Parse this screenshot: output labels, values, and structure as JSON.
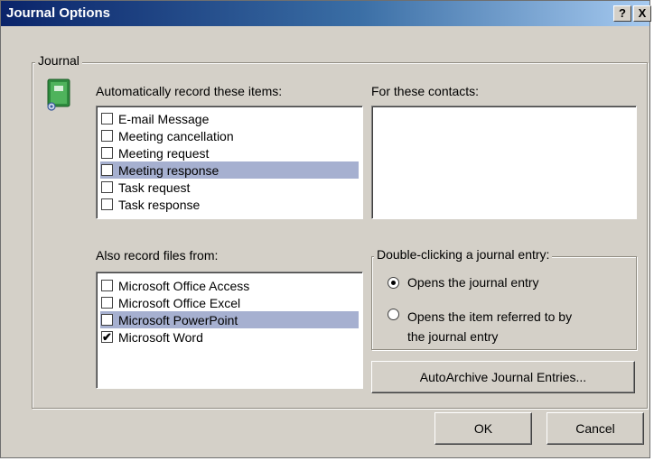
{
  "window": {
    "title": "Journal Options",
    "help_label": "?",
    "close_label": "X"
  },
  "journal_group": {
    "label": "Journal",
    "icon": "journal-icon"
  },
  "record_items": {
    "label": "Automatically record these items:",
    "items": [
      {
        "label": "E-mail Message",
        "checked": false,
        "selected": false
      },
      {
        "label": "Meeting cancellation",
        "checked": false,
        "selected": false
      },
      {
        "label": "Meeting request",
        "checked": false,
        "selected": false
      },
      {
        "label": "Meeting response",
        "checked": false,
        "selected": true
      },
      {
        "label": "Task request",
        "checked": false,
        "selected": false
      },
      {
        "label": "Task response",
        "checked": false,
        "selected": false
      }
    ]
  },
  "contacts": {
    "label": "For these contacts:"
  },
  "record_files": {
    "label": "Also record files from:",
    "items": [
      {
        "label": "Microsoft Office Access",
        "checked": false,
        "selected": false
      },
      {
        "label": "Microsoft Office Excel",
        "checked": false,
        "selected": false
      },
      {
        "label": "Microsoft PowerPoint",
        "checked": false,
        "selected": true
      },
      {
        "label": "Microsoft Word",
        "checked": true,
        "selected": false
      }
    ]
  },
  "double_click": {
    "label": "Double-clicking a journal entry:",
    "options": [
      {
        "label": "Opens the journal entry",
        "selected": true
      },
      {
        "label": "Opens the item referred to by",
        "label2": "the journal entry",
        "selected": false
      }
    ]
  },
  "buttons": {
    "autoarchive": "AutoArchive Journal Entries...",
    "ok": "OK",
    "cancel": "Cancel"
  }
}
